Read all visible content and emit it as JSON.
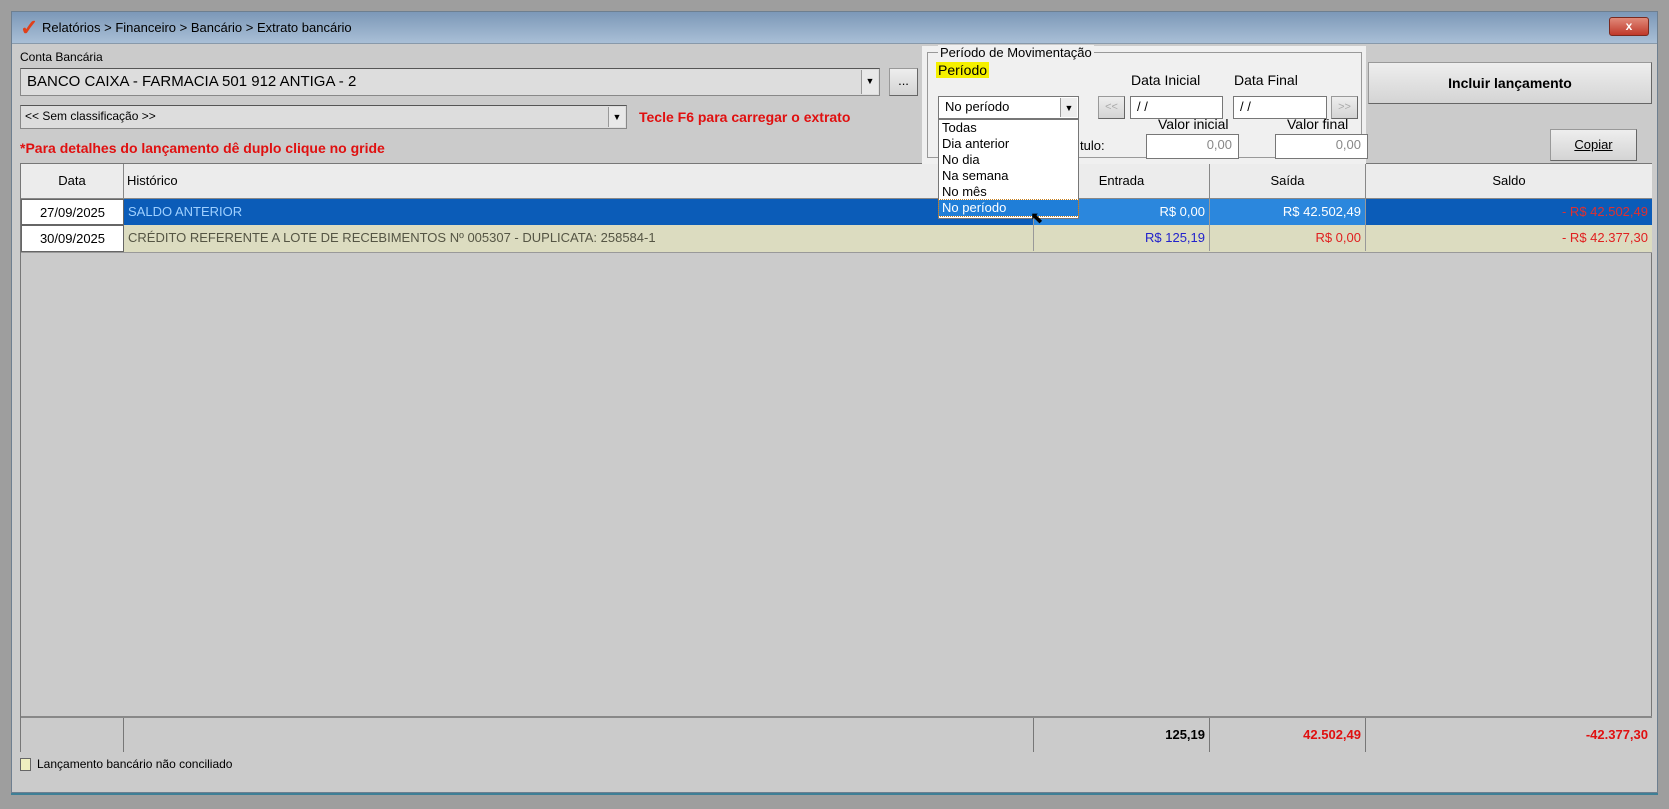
{
  "window": {
    "title": "Relatórios > Financeiro > Bancário > Extrato bancário",
    "close": "x"
  },
  "form": {
    "conta_label": "Conta Bancária",
    "conta_value": "BANCO CAIXA - FARMACIA 501 912 ANTIGA - 2",
    "ellipsis": "...",
    "classificacao": "<< Sem classificação >>",
    "hint_f6": "Tecle F6 para carregar o extrato",
    "hint_grid": "*Para detalhes do lançamento dê duplo clique no gride",
    "incluir": "Incluir lançamento",
    "copiar": "Copiar"
  },
  "periodo": {
    "group_label": "Período de Movimentação",
    "periodo_label": "Período",
    "selected": "No período",
    "options": [
      "Todas",
      "Dia anterior",
      "No dia",
      "Na semana",
      "No mês",
      "No período"
    ],
    "data_inicial_label": "Data Inicial",
    "data_inicial": " / /",
    "data_final_label": "Data Final",
    "data_final": " / /",
    "prev": "<<",
    "next": ">>",
    "valor_inicial_label": "Valor inicial",
    "valor_inicial": "0,00",
    "valor_final_label": "Valor final",
    "valor_final": "0,00",
    "titulo_partial": "tulo:"
  },
  "grid": {
    "columns": [
      "Data",
      "Histórico",
      "Entrada",
      "Saída",
      "Saldo"
    ],
    "rows": [
      {
        "data": "27/09/2025",
        "historico": "SALDO ANTERIOR",
        "entrada": "R$ 0,00",
        "saida": "R$ 42.502,49",
        "saldo": "- R$ 42.502,49"
      },
      {
        "data": "30/09/2025",
        "historico": "CRÉDITO REFERENTE A LOTE DE RECEBIMENTOS Nº 005307 - DUPLICATA: 258584-1",
        "entrada": "R$ 125,19",
        "saida": "R$ 0,00",
        "saldo": "- R$ 42.377,30"
      }
    ],
    "totals": {
      "entrada": "125,19",
      "saida": "42.502,49",
      "saldo": "-42.377,30"
    }
  },
  "legend": {
    "label": "Lançamento bancário não conciliado"
  }
}
